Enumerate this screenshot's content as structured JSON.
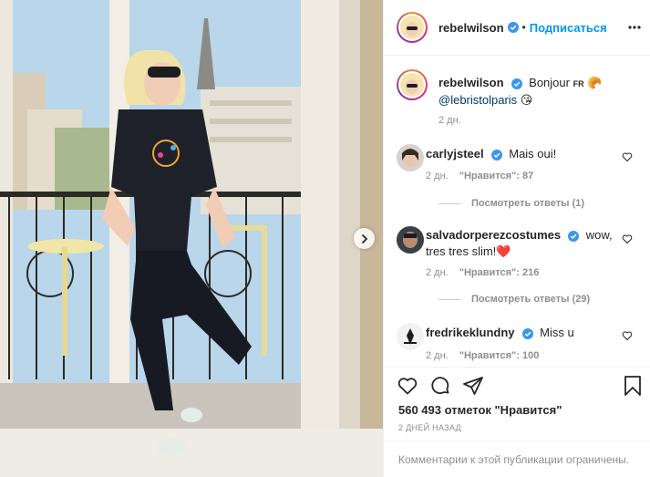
{
  "post": {
    "author": "rebelwilson",
    "follow_label": "Подписаться",
    "separator": "•",
    "icons": {
      "verified": "verified-badge-icon",
      "more": "more-options-icon",
      "next": "chevron-right-icon"
    }
  },
  "caption": {
    "username": "rebelwilson",
    "text": "Bonjour",
    "flag": "FR",
    "emoji1": "🥐",
    "mention": "@lebristolparis",
    "emoji2": "😘",
    "age": "2 дн."
  },
  "comments": [
    {
      "username": "carlyjsteel",
      "text": "Mais oui!",
      "age": "2 дн.",
      "likes": "\"Нравится\": 87",
      "replies": "Посмотреть ответы (1)"
    },
    {
      "username": "salvadorperezcostumes",
      "text": "wow, tres tres slim!",
      "emoji": "❤️",
      "age": "2 дн.",
      "likes": "\"Нравится\": 216",
      "replies": "Посмотреть ответы (29)"
    },
    {
      "username": "fredrikeklundny",
      "text": "Miss u",
      "age": "2 дн.",
      "likes": "\"Нравится\": 100"
    }
  ],
  "actions": {
    "likes_label": "560 493 отметок \"Нравится\"",
    "time_label": "2 ДНЕЙ НАЗАД",
    "restricted_label": "Комментарии к этой публикации ограничены.",
    "icons": [
      "heart-icon",
      "comment-icon",
      "share-icon",
      "bookmark-icon"
    ]
  },
  "colors": {
    "accent": "#0095f6",
    "text": "#262626",
    "muted": "#8e8e8e",
    "border": "#efefef"
  }
}
